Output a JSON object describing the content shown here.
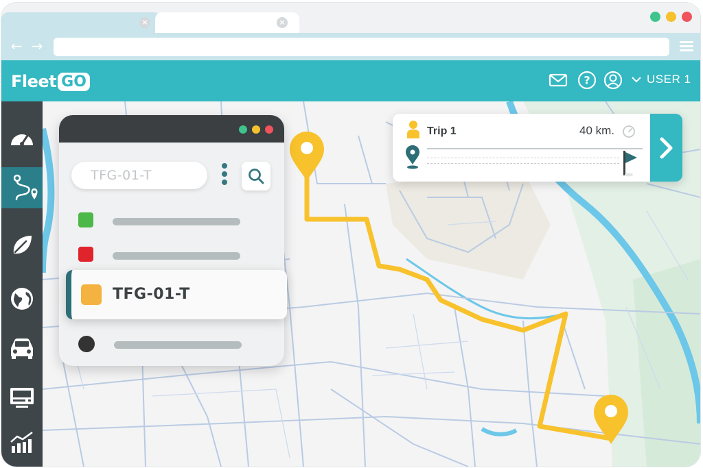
{
  "app": {
    "logo_text": "Fleet",
    "logo_box_text": "GO",
    "user_label": "USER 1",
    "accent_color": "#34b8c2",
    "sidebar_color": "#3f4649"
  },
  "header_icons": [
    "mail-icon",
    "help-icon",
    "user-icon",
    "chevron-down-icon"
  ],
  "sidebar": {
    "items": [
      {
        "name": "dashboard",
        "icon": "speedometer-icon"
      },
      {
        "name": "routes",
        "icon": "route-icon",
        "active": true
      },
      {
        "name": "eco",
        "icon": "leaf-icon"
      },
      {
        "name": "map",
        "icon": "globe-icon"
      },
      {
        "name": "vehicles",
        "icon": "car-icon"
      },
      {
        "name": "devices",
        "icon": "monitor-icon"
      },
      {
        "name": "reports",
        "icon": "chart-icon"
      }
    ]
  },
  "vehicle_panel": {
    "search_placeholder": "TFG-01-T",
    "vehicles": [
      {
        "status_color": "#4cb848",
        "label": ""
      },
      {
        "status_color": "#e0242c",
        "label": ""
      },
      {
        "status_color": "#f4b240",
        "label": "TFG-01-T",
        "selected": true
      },
      {
        "status_color": "#333333",
        "label": ""
      }
    ]
  },
  "trip": {
    "title": "Trip 1",
    "distance": "40 km."
  }
}
